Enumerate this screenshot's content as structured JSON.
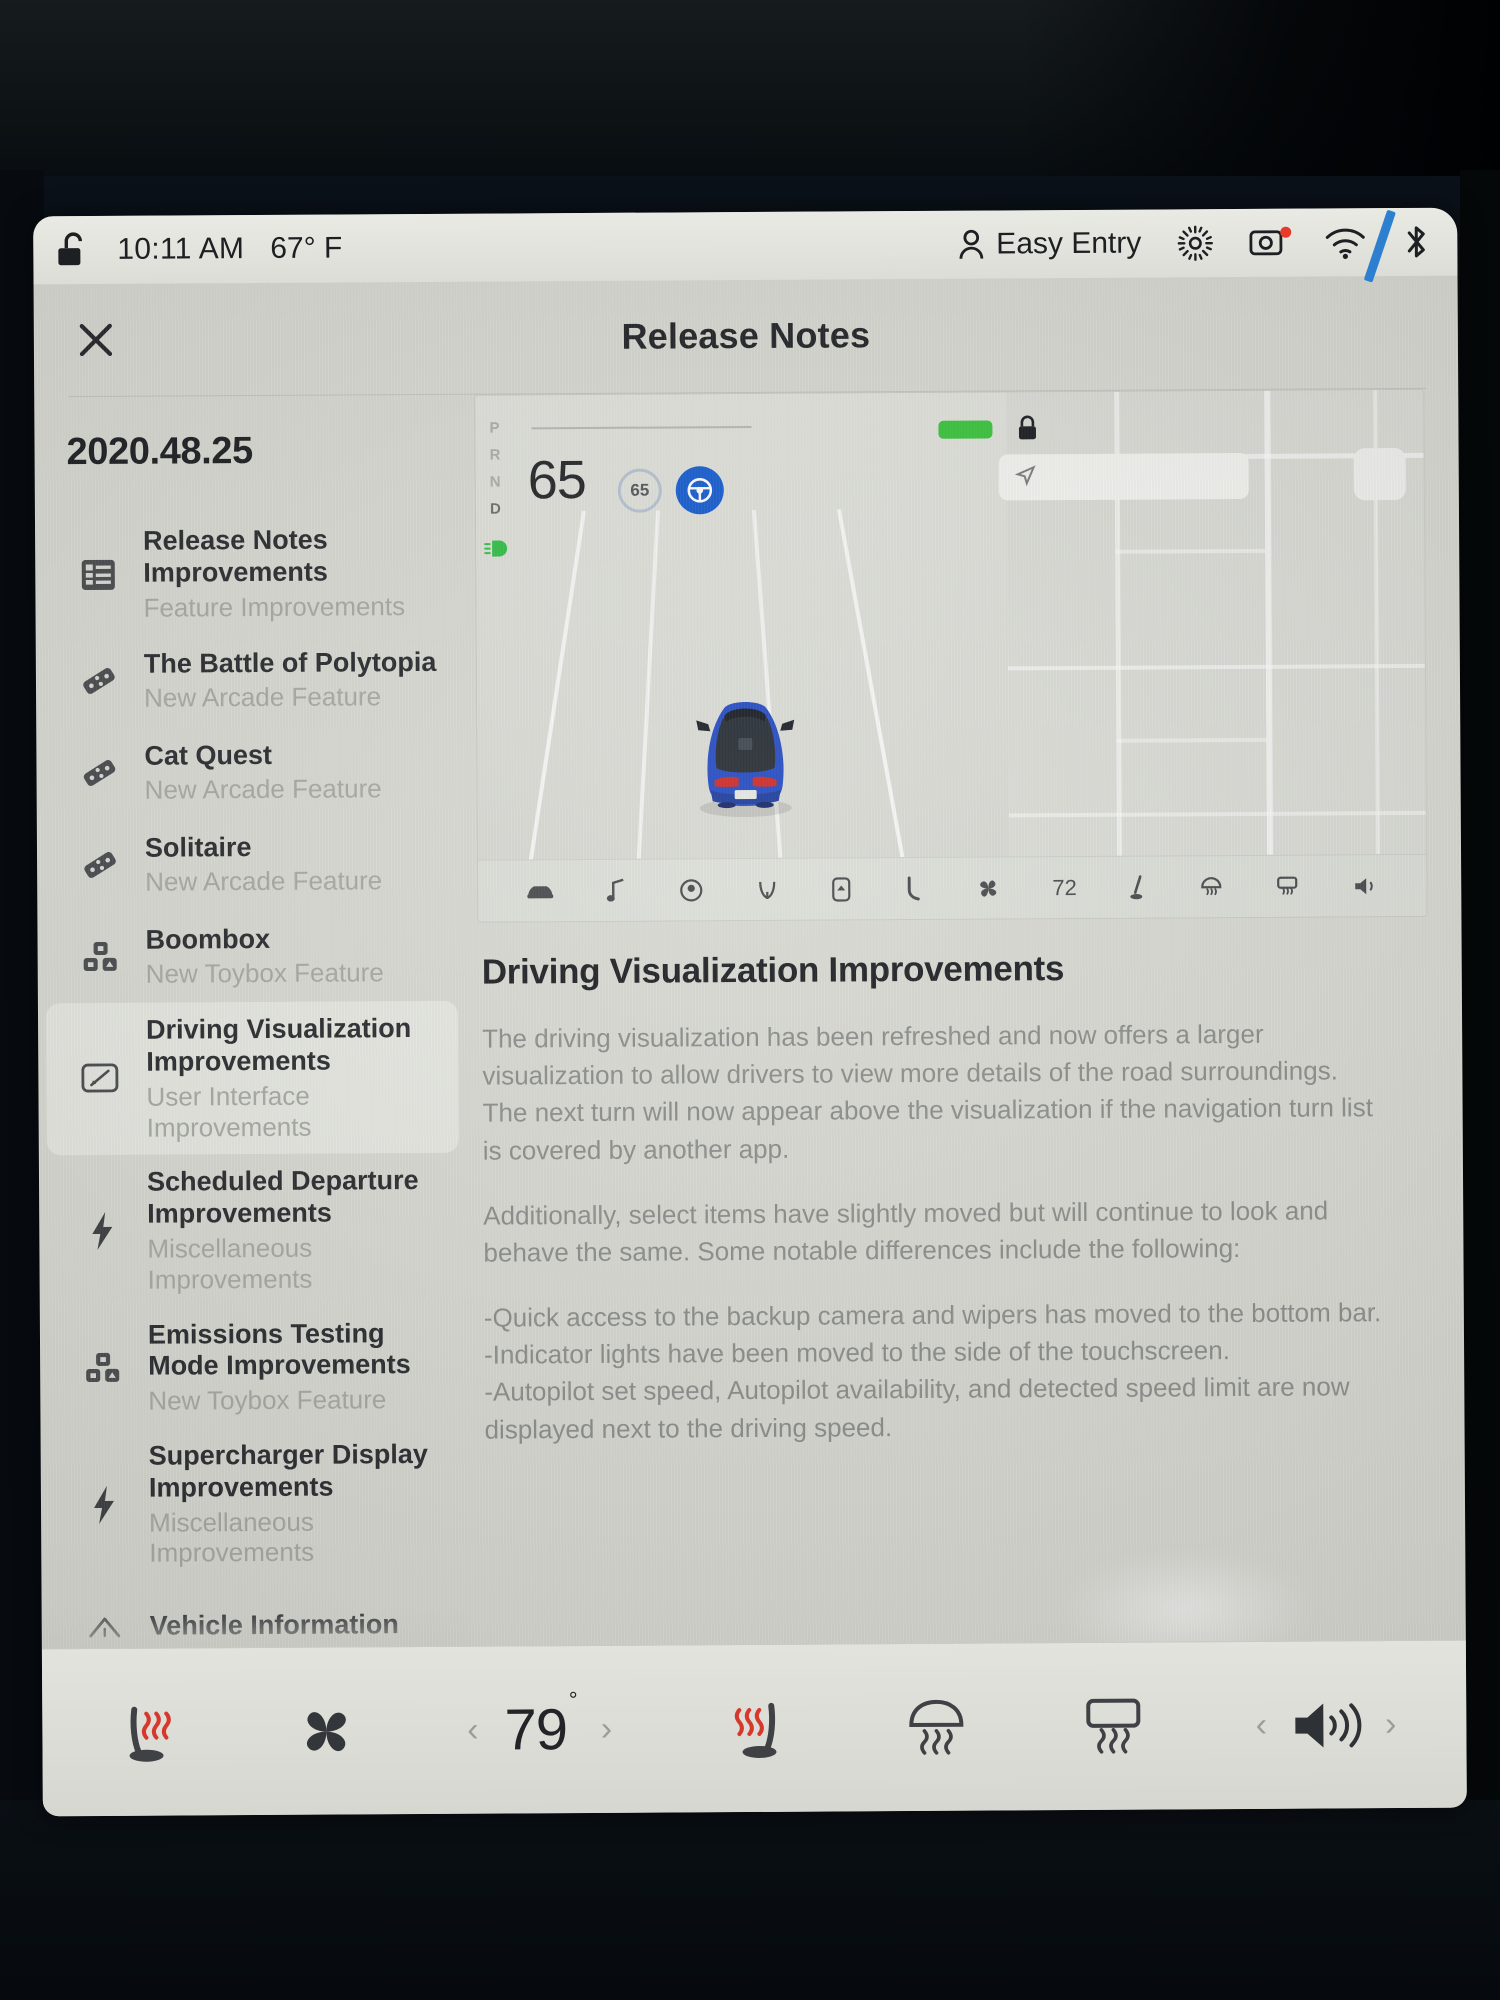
{
  "status_bar": {
    "lock_icon": "unlocked-padlock-icon",
    "time": "10:11 AM",
    "temperature": "67° F",
    "profile_icon": "person-icon",
    "profile_name": "Easy Entry",
    "brightness_icon": "brightness-sun-icon",
    "camera_icon": "dashcam-icon",
    "camera_badge_color": "#e8392b",
    "wifi_icon": "wifi-icon",
    "wifi_stripe_color": "#2d7fd0",
    "bluetooth_icon": "bluetooth-icon"
  },
  "header": {
    "close_icon": "close-x-icon",
    "title": "Release Notes"
  },
  "sidebar": {
    "version": "2020.48.25",
    "items": [
      {
        "icon": "list-icon",
        "title": "Release Notes Improvements",
        "subtitle": "Feature Improvements",
        "selected": false
      },
      {
        "icon": "dice-icon",
        "title": "The Battle of Polytopia",
        "subtitle": "New Arcade Feature",
        "selected": false
      },
      {
        "icon": "dice-icon",
        "title": "Cat Quest",
        "subtitle": "New Arcade Feature",
        "selected": false
      },
      {
        "icon": "dice-icon",
        "title": "Solitaire",
        "subtitle": "New Arcade Feature",
        "selected": false
      },
      {
        "icon": "toybox-icon",
        "title": "Boombox",
        "subtitle": "New Toybox Feature",
        "selected": false
      },
      {
        "icon": "screen-pen-icon",
        "title": "Driving Visualization Improvements",
        "subtitle": "User Interface Improvements",
        "selected": true
      },
      {
        "icon": "bolt-icon",
        "title": "Scheduled Departure Improvements",
        "subtitle": "Miscellaneous Improvements",
        "selected": false
      },
      {
        "icon": "toybox-icon",
        "title": "Emissions Testing Mode Improvements",
        "subtitle": "New Toybox Feature",
        "selected": false
      },
      {
        "icon": "bolt-icon",
        "title": "Supercharger Display Improvements",
        "subtitle": "Miscellaneous Improvements",
        "selected": false
      },
      {
        "icon": "car-front-icon",
        "title": "Vehicle Information",
        "subtitle": "",
        "selected": false
      }
    ]
  },
  "visualization": {
    "gear_letters": [
      "P",
      "R",
      "N",
      "D"
    ],
    "active_gear": "D",
    "headlight_icon": "headlight-on-icon",
    "headlight_color": "#35c04a",
    "speed": "65",
    "speed_limit": "65",
    "autopilot_icon": "steering-wheel-icon",
    "autopilot_color": "#1a5fd0",
    "battery_color": "#3cc53f",
    "lock_icon": "locked-padlock-icon",
    "nav_search_icon": "navigation-arrow-icon",
    "map_button_icon": "map-layers-button",
    "car_color": "#2a4fc4",
    "dock_icons": [
      "car-icon",
      "music-note-icon",
      "media-dial-icon",
      "wiper-icon",
      "phone-app-icon",
      "phone-handset-icon",
      "fan-icon"
    ],
    "dock_temperature": "72",
    "dock_icons_right": [
      "seat-heater-icon",
      "front-defrost-icon",
      "rear-defrost-icon",
      "volume-icon"
    ]
  },
  "article": {
    "title": "Driving Visualization Improvements",
    "paragraphs": [
      "The driving visualization has been refreshed and now offers a larger visualization to allow drivers to view more details of the road surroundings. The next turn will now appear above the visualization if the navigation turn list is covered by another app.",
      "Additionally, select items have slightly moved but will continue to look and behave the same. Some notable differences include the following:"
    ],
    "bullets": "-Quick access to the backup camera and wipers has moved to the bottom bar.\n-Indicator lights have been moved to the side of the touchscreen.\n-Autopilot set speed, Autopilot availability, and detected speed limit are now displayed next to the driving speed."
  },
  "climate_bar": {
    "left_seat_heater_icon": "heated-seat-icon",
    "fan_icon": "fan-icon",
    "temp_decrease_icon": "chevron-left-icon",
    "temperature": "79",
    "degree_symbol": "°",
    "temp_increase_icon": "chevron-right-icon",
    "right_seat_heater_icon": "heated-seat-icon",
    "front_defrost_icon": "front-defrost-icon",
    "rear_defrost_icon": "rear-defrost-icon",
    "volume_down_icon": "chevron-left-icon",
    "volume_icon": "volume-speaker-icon",
    "volume_up_icon": "chevron-right-icon"
  }
}
